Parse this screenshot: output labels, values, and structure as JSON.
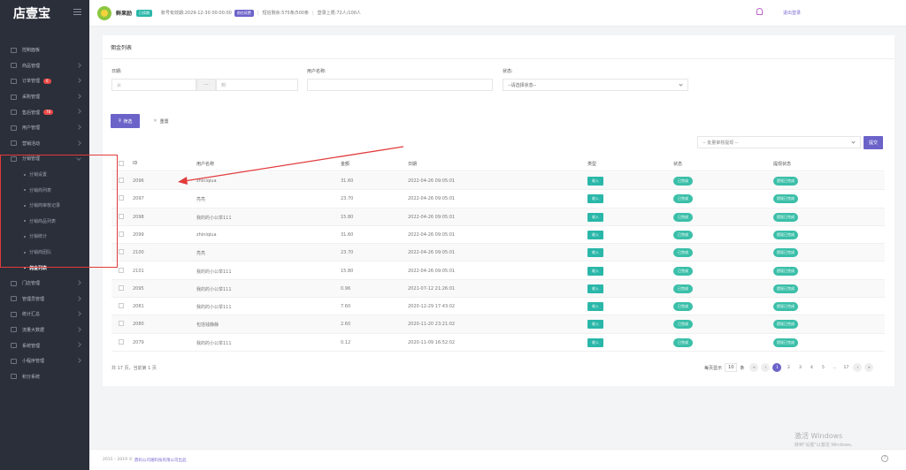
{
  "sidebar": {
    "logo": "店壹宝",
    "items": [
      {
        "label": "控制面板"
      },
      {
        "label": "商品管理"
      },
      {
        "label": "订单管理",
        "badge": "6"
      },
      {
        "label": "采购管理"
      },
      {
        "label": "售后管理",
        "badge": "78"
      },
      {
        "label": "用户管理"
      },
      {
        "label": "营销活动"
      },
      {
        "label": "分销管理"
      },
      {
        "label": "门店管理"
      },
      {
        "label": "管理员管理"
      },
      {
        "label": "统计汇总"
      },
      {
        "label": "流量大数据"
      },
      {
        "label": "系统管理"
      },
      {
        "label": "小程序管理"
      },
      {
        "label": "积分系统"
      }
    ],
    "distribution_sub": [
      "分销设置",
      "分销商列表",
      "分销商审核记录",
      "分销商品列表",
      "分销统计",
      "分销商团队",
      "佣金列表"
    ]
  },
  "header": {
    "store_name": "鲜果励",
    "store_tag": "已续期",
    "validity_label": "账号有效期:",
    "validity_value": "2029-12-30 00:00:00",
    "validity_btn": "前往续费",
    "sms_label": "短信剩余:",
    "sms_value": "575条/500条",
    "login_label": "登录上限:",
    "login_value": "72人/100人",
    "logout": "退出登录"
  },
  "card": {
    "title": "佣金列表",
    "filters": {
      "date_label": "日期:",
      "date_from_placeholder": "从",
      "date_to_placeholder": "到",
      "date_sep": "---",
      "username_label": "用户名称:",
      "username_value": "",
      "status_label": "状态:",
      "status_placeholder": "--请选择状态--"
    },
    "search_btn": "筛选",
    "reset_btn": "重置",
    "batch_placeholder": "-- 批量审核提现 --",
    "submit_btn": "提交",
    "columns": [
      "ID",
      "用户名称",
      "金额",
      "日期",
      "类型",
      "状态",
      "提现状态"
    ],
    "rows": [
      {
        "id": "2096",
        "name": "zhiniqiua",
        "amount": "31.60",
        "date": "2022-04-26 09:05:01",
        "type": "收入",
        "status": "已完成",
        "withdraw": "提现已完成"
      },
      {
        "id": "2097",
        "name": "亮亮",
        "amount": "23.70",
        "date": "2022-04-26 09:05:01",
        "type": "收入",
        "status": "已完成",
        "withdraw": "提现已完成"
      },
      {
        "id": "2098",
        "name": "我的的小公举111",
        "amount": "15.80",
        "date": "2022-04-26 09:05:01",
        "type": "收入",
        "status": "已完成",
        "withdraw": "提现已完成"
      },
      {
        "id": "2099",
        "name": "zhiniqiua",
        "amount": "31.60",
        "date": "2022-04-26 09:05:01",
        "type": "收入",
        "status": "已完成",
        "withdraw": "提现已完成"
      },
      {
        "id": "2100",
        "name": "亮亮",
        "amount": "23.70",
        "date": "2022-04-26 09:05:01",
        "type": "收入",
        "status": "已完成",
        "withdraw": "提现已完成"
      },
      {
        "id": "2101",
        "name": "我的的小公举111",
        "amount": "15.80",
        "date": "2022-04-26 09:05:01",
        "type": "收入",
        "status": "已完成",
        "withdraw": "提现已完成"
      },
      {
        "id": "2095",
        "name": "我的的小公举111",
        "amount": "0.96",
        "date": "2021-07-12 21:26:01",
        "type": "收入",
        "status": "已完成",
        "withdraw": "提现已完成"
      },
      {
        "id": "2081",
        "name": "我的的小公举111",
        "amount": "7.60",
        "date": "2020-12-29 17:43:02",
        "type": "收入",
        "status": "已完成",
        "withdraw": "提现已完成"
      },
      {
        "id": "2080",
        "name": "包括钱静静",
        "amount": "2.60",
        "date": "2020-11-20 23:21:02",
        "type": "收入",
        "status": "已完成",
        "withdraw": "提现已完成"
      },
      {
        "id": "2079",
        "name": "我的的小公举111",
        "amount": "0.12",
        "date": "2020-11-09 16:52:02",
        "type": "收入",
        "status": "已完成",
        "withdraw": "提现已完成"
      }
    ],
    "total_text": "共 17 页，当前第 1 页",
    "pager": {
      "per_page_label": "每页显示",
      "per_page_value": "10",
      "per_page_unit": "条",
      "pages": [
        "1",
        "2",
        "3",
        "4",
        "5",
        "...",
        "17"
      ]
    }
  },
  "footer": {
    "copyright": "2015 – 2019 ©",
    "company": "鼎码公司湘科技有限公司出品",
    "help": "?"
  },
  "watermark": {
    "line1": "激活 Windows",
    "line2": "转到\"设置\"以激活 Windows。"
  },
  "colors": {
    "sidebar": "#2b2f3a",
    "primary": "#6c63c9",
    "success": "#2ab7a9",
    "annotation": "#e23b3b"
  }
}
